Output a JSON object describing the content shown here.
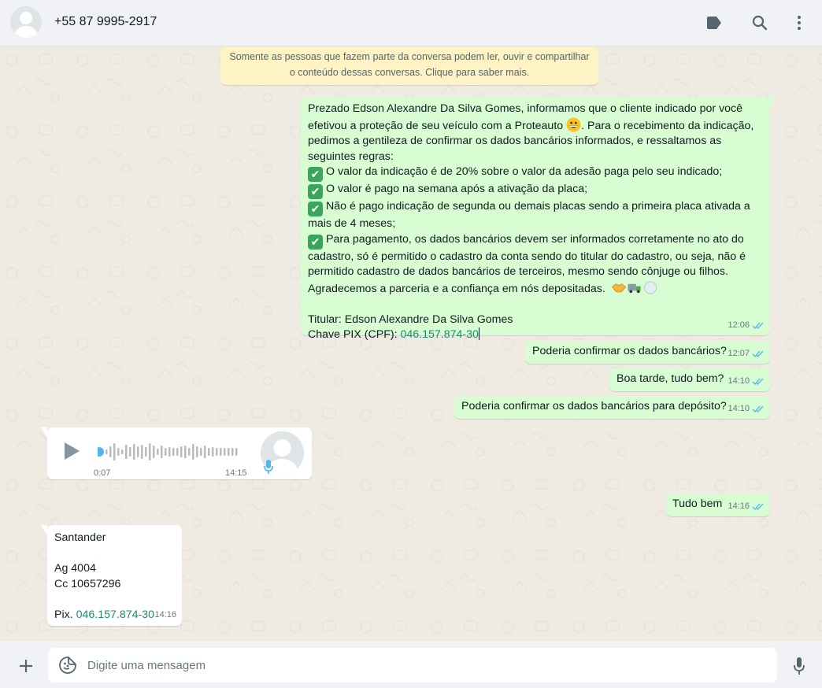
{
  "header": {
    "contact": "+55 87 9995-2917",
    "icons": [
      "avatar-default",
      "label-icon",
      "search-icon",
      "menu-kebab-icon"
    ]
  },
  "notice": {
    "line1": "Somente as pessoas que fazem parte da conversa podem ler, ouvir e compartilhar",
    "line2": "o conteúdo dessas conversas. Clique para saber mais."
  },
  "messages": {
    "m1": {
      "l1": "Prezado Edson Alexandre Da Silva Gomes, informamos que o cliente indicado por você",
      "l2a": "efetivou a proteção de seu veículo com a Proteauto ",
      "l2b": ". Para o recebimento da indicação,",
      "l3": "pedimos a gentileza de confirmar os dados bancários informados, e  ressaltamos as",
      "l4": "seguintes regras:",
      "r1": "O valor da indicação é de 20% sobre o valor da adesão paga pelo seu indicado;",
      "r2": "O valor é pago na semana após a ativação da placa;",
      "r3a": "Não é pago indicação de segunda ou demais placas sendo a primeira placa ativada a",
      "r3b": "mais de 4 meses;",
      "r4a": "Para pagamento, os dados bancários devem ser informados corretamente no ato do",
      "r4b": "cadastro, só é permitido o cadastro da conta sendo do titular do cadastro, ou seja, não é",
      "r4c": "permitido cadastro de dados bancários de terceiros, mesmo sendo cônjuge ou filhos.",
      "thanks": "Agradecemos a parceria e a confiança em nós depositadas.",
      "holder": "Titular: Edson Alexandre Da Silva Gomes",
      "pix_label": "Chave PIX (CPF): ",
      "pix_value": "046.157.874-30",
      "time": "12:06"
    },
    "m2": {
      "text": "Poderia confirmar os dados bancários?",
      "time": "12:07"
    },
    "m3": {
      "text": "Boa tarde, tudo bem?",
      "time": "14:10"
    },
    "m4": {
      "text": "Poderia confirmar os dados bancários para depósito?",
      "time": "14:10"
    },
    "audio": {
      "duration": "0:07",
      "time": "14:15",
      "progress": 0.0
    },
    "m5": {
      "text": "Tudo bem",
      "time": "14:16"
    },
    "m6": {
      "bank": "Santander",
      "ag": "Ag 4004",
      "cc": "Cc 10657296",
      "pix_label": "Pix. ",
      "pix_value": "046.157.874-30",
      "time": "14:16"
    }
  },
  "composer": {
    "placeholder": "Digite uma mensagem",
    "value": ""
  },
  "colors": {
    "outgoing": "#d9fdd3",
    "incoming": "#ffffff",
    "read_ticks": "#53bdeb",
    "notice_bg": "#fdf3c5"
  }
}
